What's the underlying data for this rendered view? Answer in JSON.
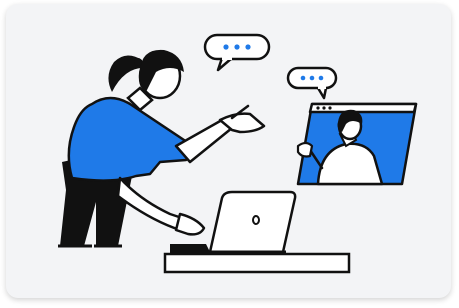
{
  "illustration": {
    "accent_color": "#1f7ae8",
    "ink_color": "#111111",
    "card_background": "#f3f4f6",
    "icons": [
      "speech-bubble-icon",
      "video-call-window-icon",
      "laptop-icon"
    ],
    "bubbles": [
      {
        "name": "speech-bubble-woman",
        "dots": 3
      },
      {
        "name": "speech-bubble-caller",
        "dots": 3
      }
    ]
  }
}
